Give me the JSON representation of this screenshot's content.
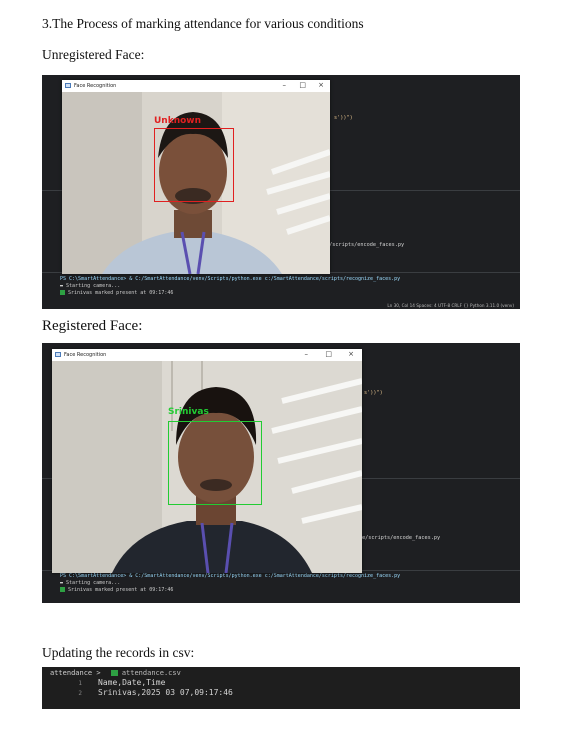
{
  "heading": "3.The Process of marking attendance for various conditions",
  "unregistered": {
    "label": "Unregistered Face:",
    "window_title": "Face Recognition",
    "face_label": "Unknown",
    "code_snippet": "s'))\")",
    "encode_path": "e/scripts/encode_faces.py",
    "terminal": {
      "command_prompt": "PS C:\\SmartAttendance> & C:/SmartAttendance/venv/Scripts/python.exe c:/SmartAttendance/scripts/recognize_faces.py",
      "line1": "Starting camera...",
      "line2": "Srinivas marked present at 09:17:46"
    },
    "status_bar": "Ln 30, Col 14   Spaces: 4   UTF-8   CRLF   {} Python   3.11.0 (venv)"
  },
  "registered": {
    "label": "Registered Face:",
    "window_title": "Face Recognition",
    "face_label": "Srinivas",
    "code_snippet": "s'))\")",
    "encode_path": "e/scripts/encode_faces.py",
    "terminal": {
      "command_prompt": "PS C:\\SmartAttendance> & C:/SmartAttendance/venv/Scripts/python.exe c:/SmartAttendance/scripts/recognize_faces.py",
      "line1": "Starting camera...",
      "line2": "Srinivas marked present at 09:17:46"
    }
  },
  "csv_section": {
    "label": "Updating the records in csv:",
    "breadcrumb_folder": "attendance",
    "breadcrumb_file": "attendance.csv",
    "rows": [
      {
        "line": "1",
        "text": "Name,Date,Time"
      },
      {
        "line": "2",
        "text": "Srinivas,2025 03 07,09:17:46"
      }
    ]
  },
  "colors": {
    "unknown_box": "#e02020",
    "recognized_box": "#22cc33",
    "editor_bg": "#1e1f22"
  }
}
